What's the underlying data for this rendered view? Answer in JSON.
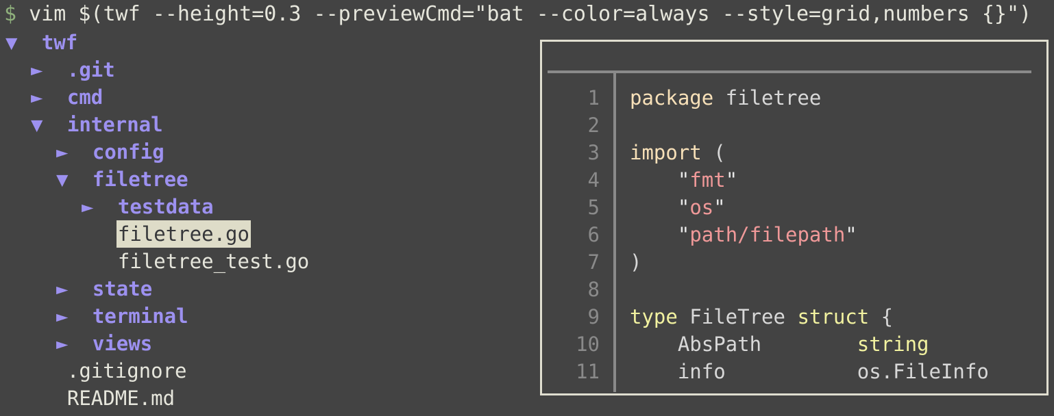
{
  "terminal": {
    "background_color": "#434343",
    "foreground_color": "#e6e6dc"
  },
  "command_line": {
    "prompt": "$",
    "command": " vim $(twf --height=0.3 --previewCmd=\"bat --color=always --style=grid,numbers {}\")",
    "prompt_color": "#8fb07c"
  },
  "file_tree": {
    "directory_color": "#9d91f0",
    "file_color": "#e6e6dc",
    "selection_background": "#dedcc8",
    "selection_foreground": "#36373a",
    "expanded_arrow": "▼",
    "collapsed_arrow": "►",
    "rows": [
      {
        "indent": 0,
        "arrow": "▼",
        "label": "twf",
        "kind": "dir",
        "selected": false
      },
      {
        "indent": 1,
        "arrow": "►",
        "label": ".git",
        "kind": "dir",
        "selected": false
      },
      {
        "indent": 1,
        "arrow": "►",
        "label": "cmd",
        "kind": "dir",
        "selected": false
      },
      {
        "indent": 1,
        "arrow": "▼",
        "label": "internal",
        "kind": "dir",
        "selected": false
      },
      {
        "indent": 2,
        "arrow": "►",
        "label": "config",
        "kind": "dir",
        "selected": false
      },
      {
        "indent": 2,
        "arrow": "▼",
        "label": "filetree",
        "kind": "dir",
        "selected": false
      },
      {
        "indent": 3,
        "arrow": "►",
        "label": "testdata",
        "kind": "dir",
        "selected": false
      },
      {
        "indent": 3,
        "arrow": "",
        "label": "filetree.go",
        "kind": "file",
        "selected": true
      },
      {
        "indent": 3,
        "arrow": "",
        "label": "filetree_test.go",
        "kind": "file",
        "selected": false
      },
      {
        "indent": 2,
        "arrow": "►",
        "label": "state",
        "kind": "dir",
        "selected": false
      },
      {
        "indent": 2,
        "arrow": "►",
        "label": "terminal",
        "kind": "dir",
        "selected": false
      },
      {
        "indent": 2,
        "arrow": "►",
        "label": "views",
        "kind": "dir",
        "selected": false
      },
      {
        "indent": 1,
        "arrow": "",
        "label": ".gitignore",
        "kind": "file",
        "selected": false
      },
      {
        "indent": 1,
        "arrow": "",
        "label": "README.md",
        "kind": "file",
        "selected": false
      }
    ]
  },
  "preview_panel": {
    "border_color": "#e0ded0",
    "grid_color": "#8a8a8a",
    "lineno_color": "#8a8a8a",
    "syntax_colors": {
      "plain": "#d8d8d8",
      "keyword": "#f7e0b8",
      "type": "#f2f2a0",
      "string": "#f09999",
      "quote": "#e8e8e8"
    },
    "lines": [
      {
        "no": "1",
        "tokens": [
          {
            "t": "package",
            "c": "keyword"
          },
          {
            "t": " filetree",
            "c": "plain"
          }
        ]
      },
      {
        "no": "2",
        "tokens": [
          {
            "t": "",
            "c": "plain"
          }
        ]
      },
      {
        "no": "3",
        "tokens": [
          {
            "t": "import",
            "c": "keyword"
          },
          {
            "t": " (",
            "c": "plain"
          }
        ]
      },
      {
        "no": "4",
        "tokens": [
          {
            "t": "    \"",
            "c": "quote"
          },
          {
            "t": "fmt",
            "c": "string"
          },
          {
            "t": "\"",
            "c": "quote"
          }
        ]
      },
      {
        "no": "5",
        "tokens": [
          {
            "t": "    \"",
            "c": "quote"
          },
          {
            "t": "os",
            "c": "string"
          },
          {
            "t": "\"",
            "c": "quote"
          }
        ]
      },
      {
        "no": "6",
        "tokens": [
          {
            "t": "    \"",
            "c": "quote"
          },
          {
            "t": "path/filepath",
            "c": "string"
          },
          {
            "t": "\"",
            "c": "quote"
          }
        ]
      },
      {
        "no": "7",
        "tokens": [
          {
            "t": ")",
            "c": "plain"
          }
        ]
      },
      {
        "no": "8",
        "tokens": [
          {
            "t": "",
            "c": "plain"
          }
        ]
      },
      {
        "no": "9",
        "tokens": [
          {
            "t": "type",
            "c": "type"
          },
          {
            "t": " FileTree ",
            "c": "plain"
          },
          {
            "t": "struct",
            "c": "type"
          },
          {
            "t": " {",
            "c": "plain"
          }
        ]
      },
      {
        "no": "10",
        "tokens": [
          {
            "t": "    AbsPath        ",
            "c": "plain"
          },
          {
            "t": "string",
            "c": "type"
          }
        ]
      },
      {
        "no": "11",
        "tokens": [
          {
            "t": "    info           os.FileInfo",
            "c": "plain"
          }
        ]
      }
    ]
  }
}
